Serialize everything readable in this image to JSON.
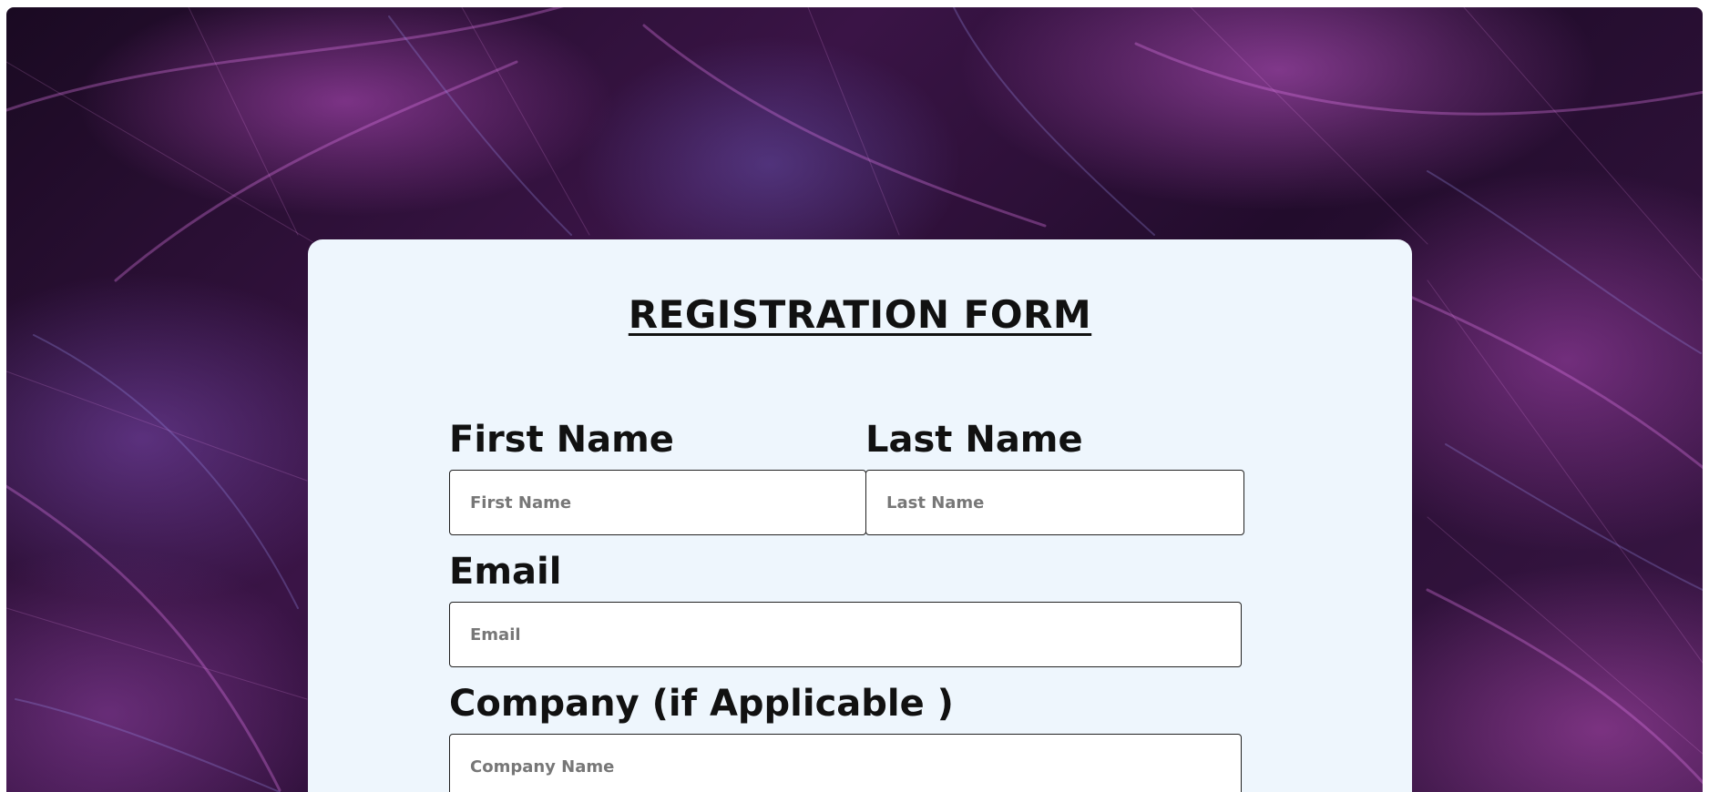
{
  "form": {
    "title": "REGISTRATION FORM",
    "first_name": {
      "label": "First Name",
      "placeholder": "First Name",
      "value": ""
    },
    "last_name": {
      "label": "Last Name",
      "placeholder": "Last Name",
      "value": ""
    },
    "email": {
      "label": "Email",
      "placeholder": "Email",
      "value": ""
    },
    "company": {
      "label": "Company (if Applicable )",
      "placeholder": "Company Name",
      "value": ""
    }
  },
  "colors": {
    "card_background": "#eef6fd",
    "text": "#111111",
    "field_border": "#222222",
    "background_accent": "#b04cc0"
  }
}
